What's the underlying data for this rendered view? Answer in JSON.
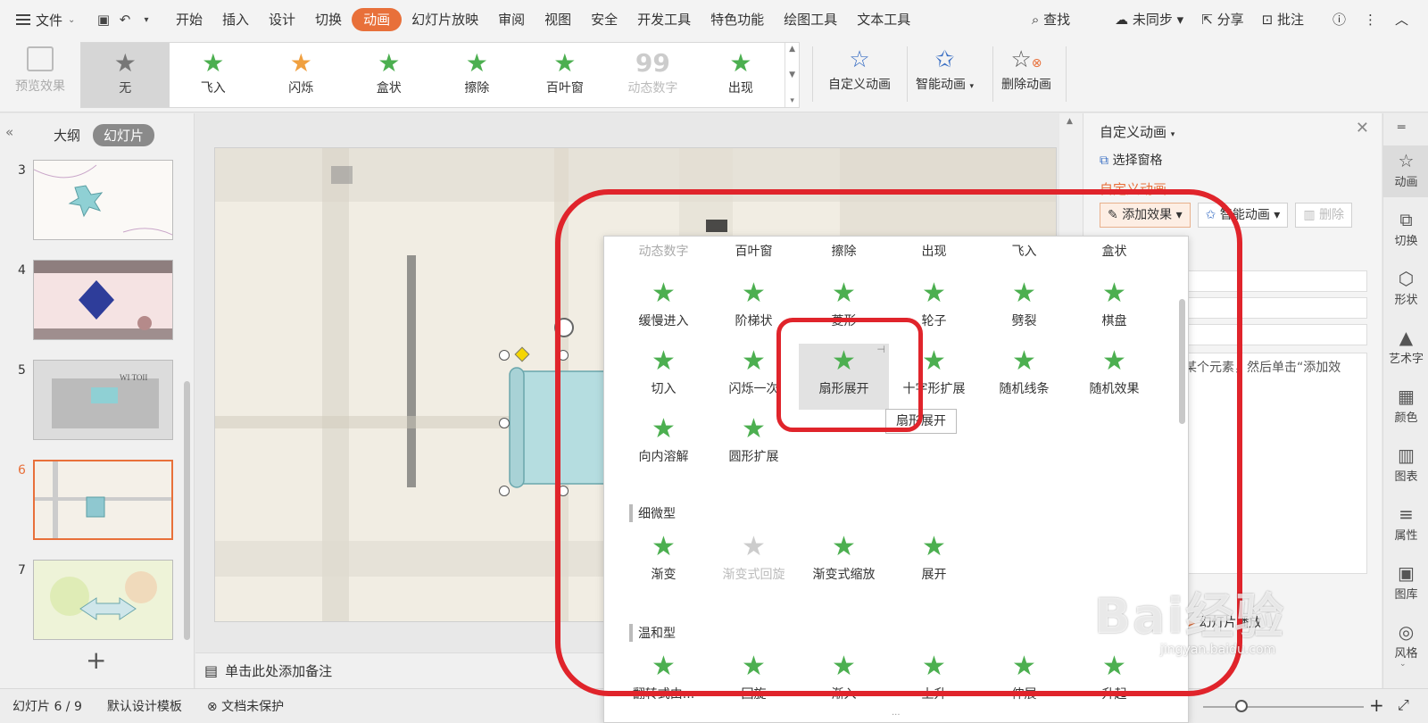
{
  "menubar": {
    "file_label": "文件",
    "tabs": [
      "开始",
      "插入",
      "设计",
      "切换",
      "动画",
      "幻灯片放映",
      "审阅",
      "视图",
      "安全",
      "开发工具",
      "特色功能",
      "绘图工具",
      "文本工具"
    ],
    "active_tab": "动画",
    "search_label": "查找",
    "sync_label": "未同步",
    "share_label": "分享",
    "comment_label": "批注",
    "accent_color": "#e8703a"
  },
  "ribbon": {
    "preview_label": "预览效果",
    "gallery": [
      {
        "label": "无",
        "icon": "star-gray-icon",
        "selected": true
      },
      {
        "label": "飞入",
        "icon": "star-fly-icon"
      },
      {
        "label": "闪烁",
        "icon": "star-flash-icon"
      },
      {
        "label": "盒状",
        "icon": "star-box-icon"
      },
      {
        "label": "擦除",
        "icon": "star-wipe-icon"
      },
      {
        "label": "百叶窗",
        "icon": "star-blinds-icon"
      },
      {
        "label": "动态数字",
        "icon": "digits-icon",
        "disabled": true
      },
      {
        "label": "出现",
        "icon": "star-appear-icon"
      }
    ],
    "custom_anim_label": "自定义动画",
    "smart_anim_label": "智能动画",
    "delete_anim_label": "删除动画"
  },
  "left_panel": {
    "tab_outline": "大纲",
    "tab_slides": "幻灯片",
    "slides": [
      {
        "num": "3",
        "current": false
      },
      {
        "num": "4",
        "current": false
      },
      {
        "num": "5",
        "current": false
      },
      {
        "num": "6",
        "current": true
      },
      {
        "num": "7",
        "current": false
      }
    ]
  },
  "notes_placeholder": "单击此处添加备注",
  "dropdown": {
    "top_row": [
      {
        "label": "动态数字",
        "disabled": true
      },
      {
        "label": "百叶窗"
      },
      {
        "label": "擦除"
      },
      {
        "label": "出现"
      },
      {
        "label": "飞入"
      },
      {
        "label": "盒状"
      }
    ],
    "row1": [
      "缓慢进入",
      "阶梯状",
      "菱形",
      "轮子",
      "劈裂",
      "棋盘"
    ],
    "row2": [
      "切入",
      "闪烁一次",
      "扇形展开",
      "十字形扩展",
      "随机线条",
      "随机效果"
    ],
    "row3": [
      "向内溶解",
      "圆形扩展"
    ],
    "highlighted": "扇形展开",
    "section_subtle": "细微型",
    "row4": [
      {
        "label": "渐变"
      },
      {
        "label": "渐变式回旋",
        "disabled": true
      },
      {
        "label": "渐变式缩放"
      },
      {
        "label": "展开"
      }
    ],
    "section_moderate": "温和型",
    "row5": [
      "翻转式由...",
      "回旋",
      "渐入",
      "上升",
      "伸展",
      "升起"
    ],
    "tooltip": "扇形展开"
  },
  "task_pane": {
    "title": "自定义动画",
    "select_pane": "选择窗格",
    "section_title": "自定义动画",
    "add_effect": "添加效果",
    "smart_anim": "智能动画",
    "delete": "删除",
    "hint": "选中幻灯片的某个元素，然后单击“添加效果”添加动画。",
    "play": "幻灯片播放"
  },
  "side_toolbar": [
    {
      "label": "动画",
      "icon": "animation-icon",
      "active": true
    },
    {
      "label": "切换",
      "icon": "transition-icon"
    },
    {
      "label": "形状",
      "icon": "shape-icon"
    },
    {
      "label": "艺术字",
      "icon": "wordart-icon"
    },
    {
      "label": "颜色",
      "icon": "color-icon"
    },
    {
      "label": "图表",
      "icon": "chart-icon"
    },
    {
      "label": "属性",
      "icon": "properties-icon"
    },
    {
      "label": "图库",
      "icon": "gallery-icon"
    },
    {
      "label": "风格",
      "icon": "style-icon"
    }
  ],
  "statusbar": {
    "slide_info": "幻灯片 6 / 9",
    "template": "默认设计模板",
    "protection": "文档未保护"
  },
  "watermark": {
    "text": "Bai经验",
    "sub": "jingyan.baidu.com"
  }
}
